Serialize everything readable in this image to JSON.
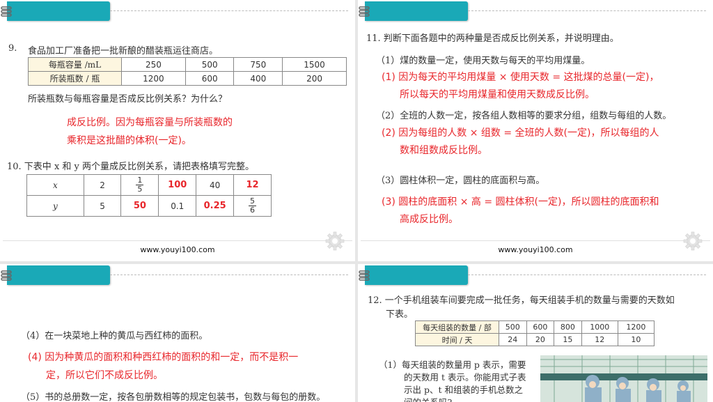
{
  "footer_url": "www.youyi100.com",
  "s1": {
    "q9_num": "9.",
    "q9_text": "食品加工厂准备把一批新酿的醋装瓶运往商店。",
    "q9_table": {
      "row1": [
        "每瓶容量 /mL",
        "250",
        "500",
        "750",
        "1500"
      ],
      "row2": [
        "所装瓶数 / 瓶",
        "1200",
        "600",
        "400",
        "200"
      ]
    },
    "q9_question": "所装瓶数与每瓶容量是否成反比例关系？为什么？",
    "q9_answer_1": "成反比例。因为每瓶容量与所装瓶数的",
    "q9_answer_2": "乘积是这批醋的体积(一定)。",
    "q10_text": "10.  下表中 x 和 y 两个量成反比例关系，请把表格填写完整。",
    "q10_table": {
      "x_label": "x",
      "y_label": "y",
      "x_1": "2",
      "x_2_num": "1",
      "x_2_den": "5",
      "x_3": "100",
      "x_4": "40",
      "x_5": "12",
      "y_1": "5",
      "y_2": "50",
      "y_3": "0.1",
      "y_4": "0.25",
      "y_5_num": "5",
      "y_5_den": "6"
    }
  },
  "s2": {
    "q11_text": "11.  判断下面各题中的两种量是否成反比例关系，并说明理由。",
    "p1": "（1）煤的数量一定，使用天数与每天的平均用煤量。",
    "a1_1": "(1) 因为每天的平均用煤量 × 使用天数 = 这批煤的总量(一定)，",
    "a1_2": "所以每天的平均用煤量和使用天数成反比例。",
    "p2": "（2）全班的人数一定，按各组人数相等的要求分组，组数与每组的人数。",
    "a2_1": "(2) 因为每组的人数 × 组数 = 全班的人数(一定)，所以每组的人",
    "a2_2": "数和组数成反比例。",
    "p3": "（3）圆柱体积一定，圆柱的底面积与高。",
    "a3_1": "(3) 圆柱的底面积 × 高 = 圆柱体积(一定)，所以圆柱的底面积和",
    "a3_2": "高成反比例。"
  },
  "s3": {
    "p4": "（4）在一块菜地上种的黄瓜与西红柿的面积。",
    "a4_1": "(4) 因为种黄瓜的面积和种西红柿的面积的和一定，而不是积一",
    "a4_2": "定，所以它们不成反比例。",
    "p5": "（5）书的总册数一定，按各包册数相等的规定包装书，包数与每包的册数。"
  },
  "s4": {
    "q12_text_1": "12.  一个手机组装车间要完成一批任务，每天组装手机的数量与需要的天数如",
    "q12_text_2": "下表。",
    "q12_table": {
      "row1": [
        "每天组装的数量 / 部",
        "500",
        "600",
        "800",
        "1000",
        "1200"
      ],
      "row2": [
        "时间 / 天",
        "24",
        "20",
        "15",
        "12",
        "10"
      ]
    },
    "p1_1": "（1）每天组装的数量用 p 表示，需要",
    "p1_2": "的天数用 t 表示。你能用式子表",
    "p1_3": "示出 p、t 和组装的手机总数之",
    "p1_4": "间的关系吗?"
  },
  "colors": {
    "accent": "#1aa9b7",
    "answer_red": "#e8262b",
    "table_header_bg": "#fdf6e0"
  }
}
